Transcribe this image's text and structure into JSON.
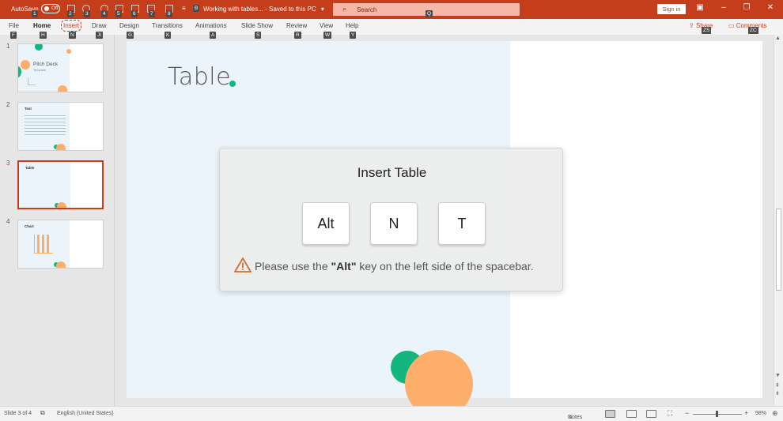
{
  "titlebar": {
    "autosave_label": "AutoSave",
    "autosave_state": "Off",
    "document_title": "Working with tables...",
    "save_status": "Saved to this PC",
    "search_placeholder": "Search",
    "signin_label": "Sign in",
    "colors": {
      "accent": "#c43e1c"
    }
  },
  "keytips": {
    "qat": [
      "1",
      "2",
      "3",
      "4",
      "5",
      "6",
      "7",
      "8"
    ],
    "title": "B",
    "search": "Q",
    "tabs": [
      "F",
      "H",
      "N",
      "JI",
      "G",
      "K",
      "A",
      "S",
      "R",
      "W",
      "Y"
    ],
    "share": "ZS",
    "comments": "ZC"
  },
  "ribbon": {
    "tabs": [
      "File",
      "Home",
      "Insert",
      "Draw",
      "Design",
      "Transitions",
      "Animations",
      "Slide Show",
      "Review",
      "View",
      "Help"
    ],
    "active_tab": "Home",
    "focused_tab": "Insert",
    "share_label": "Share",
    "comments_label": "Comments"
  },
  "thumbnails": [
    {
      "number": "1",
      "title": "Pitch Deck",
      "subtitle": "Template"
    },
    {
      "number": "2",
      "title": "Text"
    },
    {
      "number": "3",
      "title": "Table"
    },
    {
      "number": "4",
      "title": "Chart"
    }
  ],
  "selected_slide": "3",
  "slide": {
    "title": "Table"
  },
  "overlay": {
    "title": "Insert Table",
    "keys": [
      "Alt",
      "N",
      "T"
    ],
    "notice_prefix": "Please use the ",
    "notice_key": "\"Alt\"",
    "notice_suffix": " key on the left side of the spacebar."
  },
  "statusbar": {
    "slide_info": "Slide 3 of 4",
    "language": "English (United States)",
    "notes_label": "Notes",
    "zoom": "98%"
  }
}
